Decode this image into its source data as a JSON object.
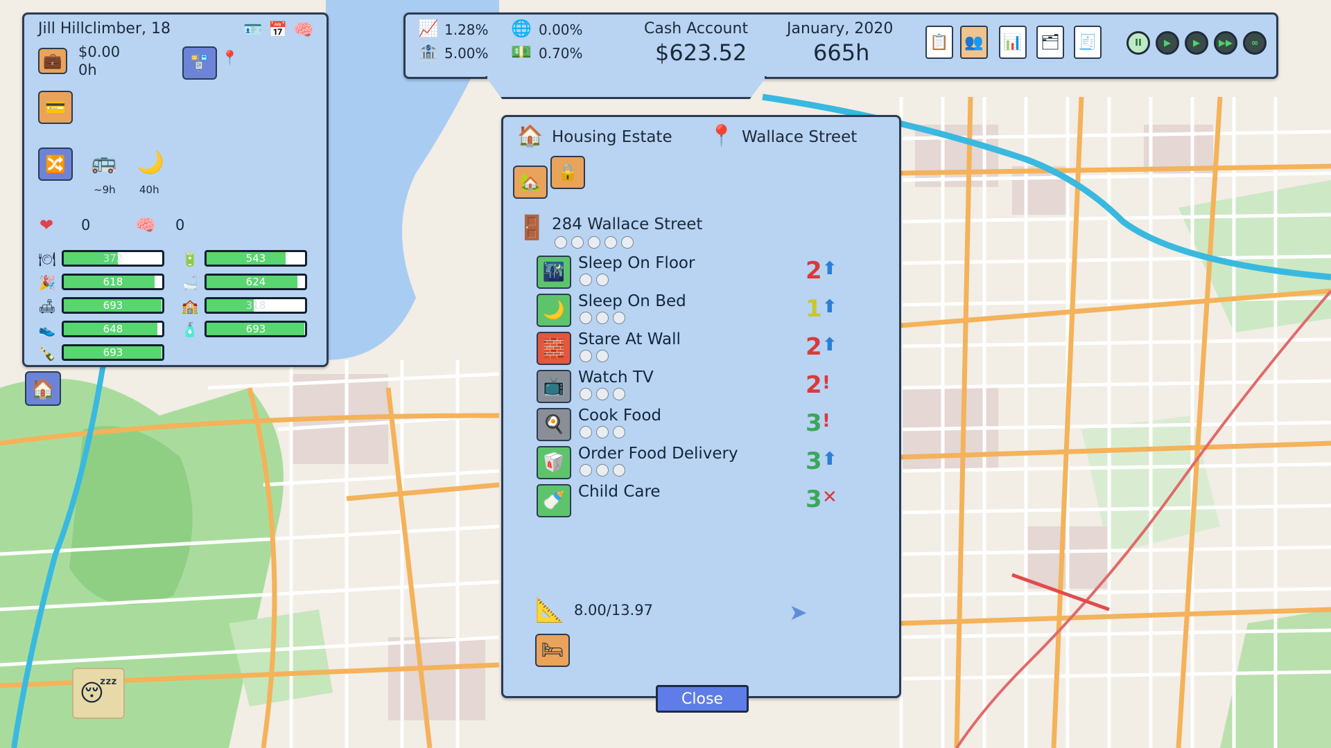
{
  "character": {
    "name": "Jill Hillclimber, 18",
    "job_pay": "$0.00",
    "job_hours": "0h",
    "commute_time": "~9h",
    "sleep_time": "40h",
    "health": "0",
    "happiness": "0",
    "stats_left": [
      {
        "icon": "food-icon",
        "value": "372",
        "level": 0.55
      },
      {
        "icon": "fun-icon",
        "value": "618",
        "level": 0.92
      },
      {
        "icon": "comfort-icon",
        "value": "693",
        "level": 0.99
      },
      {
        "icon": "fitness-icon",
        "value": "648",
        "level": 0.95
      },
      {
        "icon": "social-icon",
        "value": "693",
        "level": 0.99
      }
    ],
    "stats_right": [
      {
        "icon": "energy-icon",
        "value": "543",
        "level": 0.8
      },
      {
        "icon": "hygiene-icon",
        "value": "624",
        "level": 0.92
      },
      {
        "icon": "family-icon",
        "value": "318",
        "level": 0.48
      },
      {
        "icon": "hunger-icon",
        "value": "693",
        "level": 0.99
      }
    ]
  },
  "top_bar": {
    "stock_rate": "1.28%",
    "bank_rate": "5.00%",
    "global_rate": "0.00%",
    "cash_rate": "0.70%",
    "cash_account_label": "Cash Account",
    "cash_amount": "$623.52",
    "date": "January, 2020",
    "hours": "665h"
  },
  "housing": {
    "type": "Housing Estate",
    "street": "Wallace Street",
    "address": "284 Wallace Street",
    "space": "8.00/13.97",
    "close_label": "Close",
    "actions": [
      {
        "label": "Sleep On Floor",
        "cost": "2",
        "cost_class": "c2",
        "mark": "up",
        "reqs": 2,
        "icon": "sleep-floor-icon",
        "bg": "#5ec46b"
      },
      {
        "label": "Sleep On Bed",
        "cost": "1",
        "cost_class": "c1",
        "mark": "up",
        "reqs": 3,
        "icon": "sleep-bed-icon",
        "bg": "#5ec46b"
      },
      {
        "label": "Stare At Wall",
        "cost": "2",
        "cost_class": "c2",
        "mark": "up",
        "reqs": 2,
        "icon": "brick-wall-icon",
        "bg": "#e2573e"
      },
      {
        "label": "Watch TV",
        "cost": "2",
        "cost_class": "c2",
        "mark": "!",
        "reqs": 3,
        "icon": "tv-icon",
        "bg": "#8a8f97"
      },
      {
        "label": "Cook Food",
        "cost": "3",
        "cost_class": "c3",
        "mark": "!",
        "reqs": 3,
        "icon": "cooking-pot-icon",
        "bg": "#8a8f97"
      },
      {
        "label": "Order Food Delivery",
        "cost": "3",
        "cost_class": "c3",
        "mark": "up",
        "reqs": 3,
        "icon": "food-delivery-icon",
        "bg": "#5ec46b"
      },
      {
        "label": "Child Care",
        "cost": "3",
        "cost_class": "c3",
        "mark": "x",
        "reqs": 0,
        "icon": "baby-bottle-icon",
        "bg": "#5ec46b"
      }
    ]
  },
  "colors": {
    "panel_bg": "#b9d3f2",
    "panel_border": "#2a3b52",
    "bar_fill": "#58d66f",
    "close_button": "#5f7de8"
  }
}
